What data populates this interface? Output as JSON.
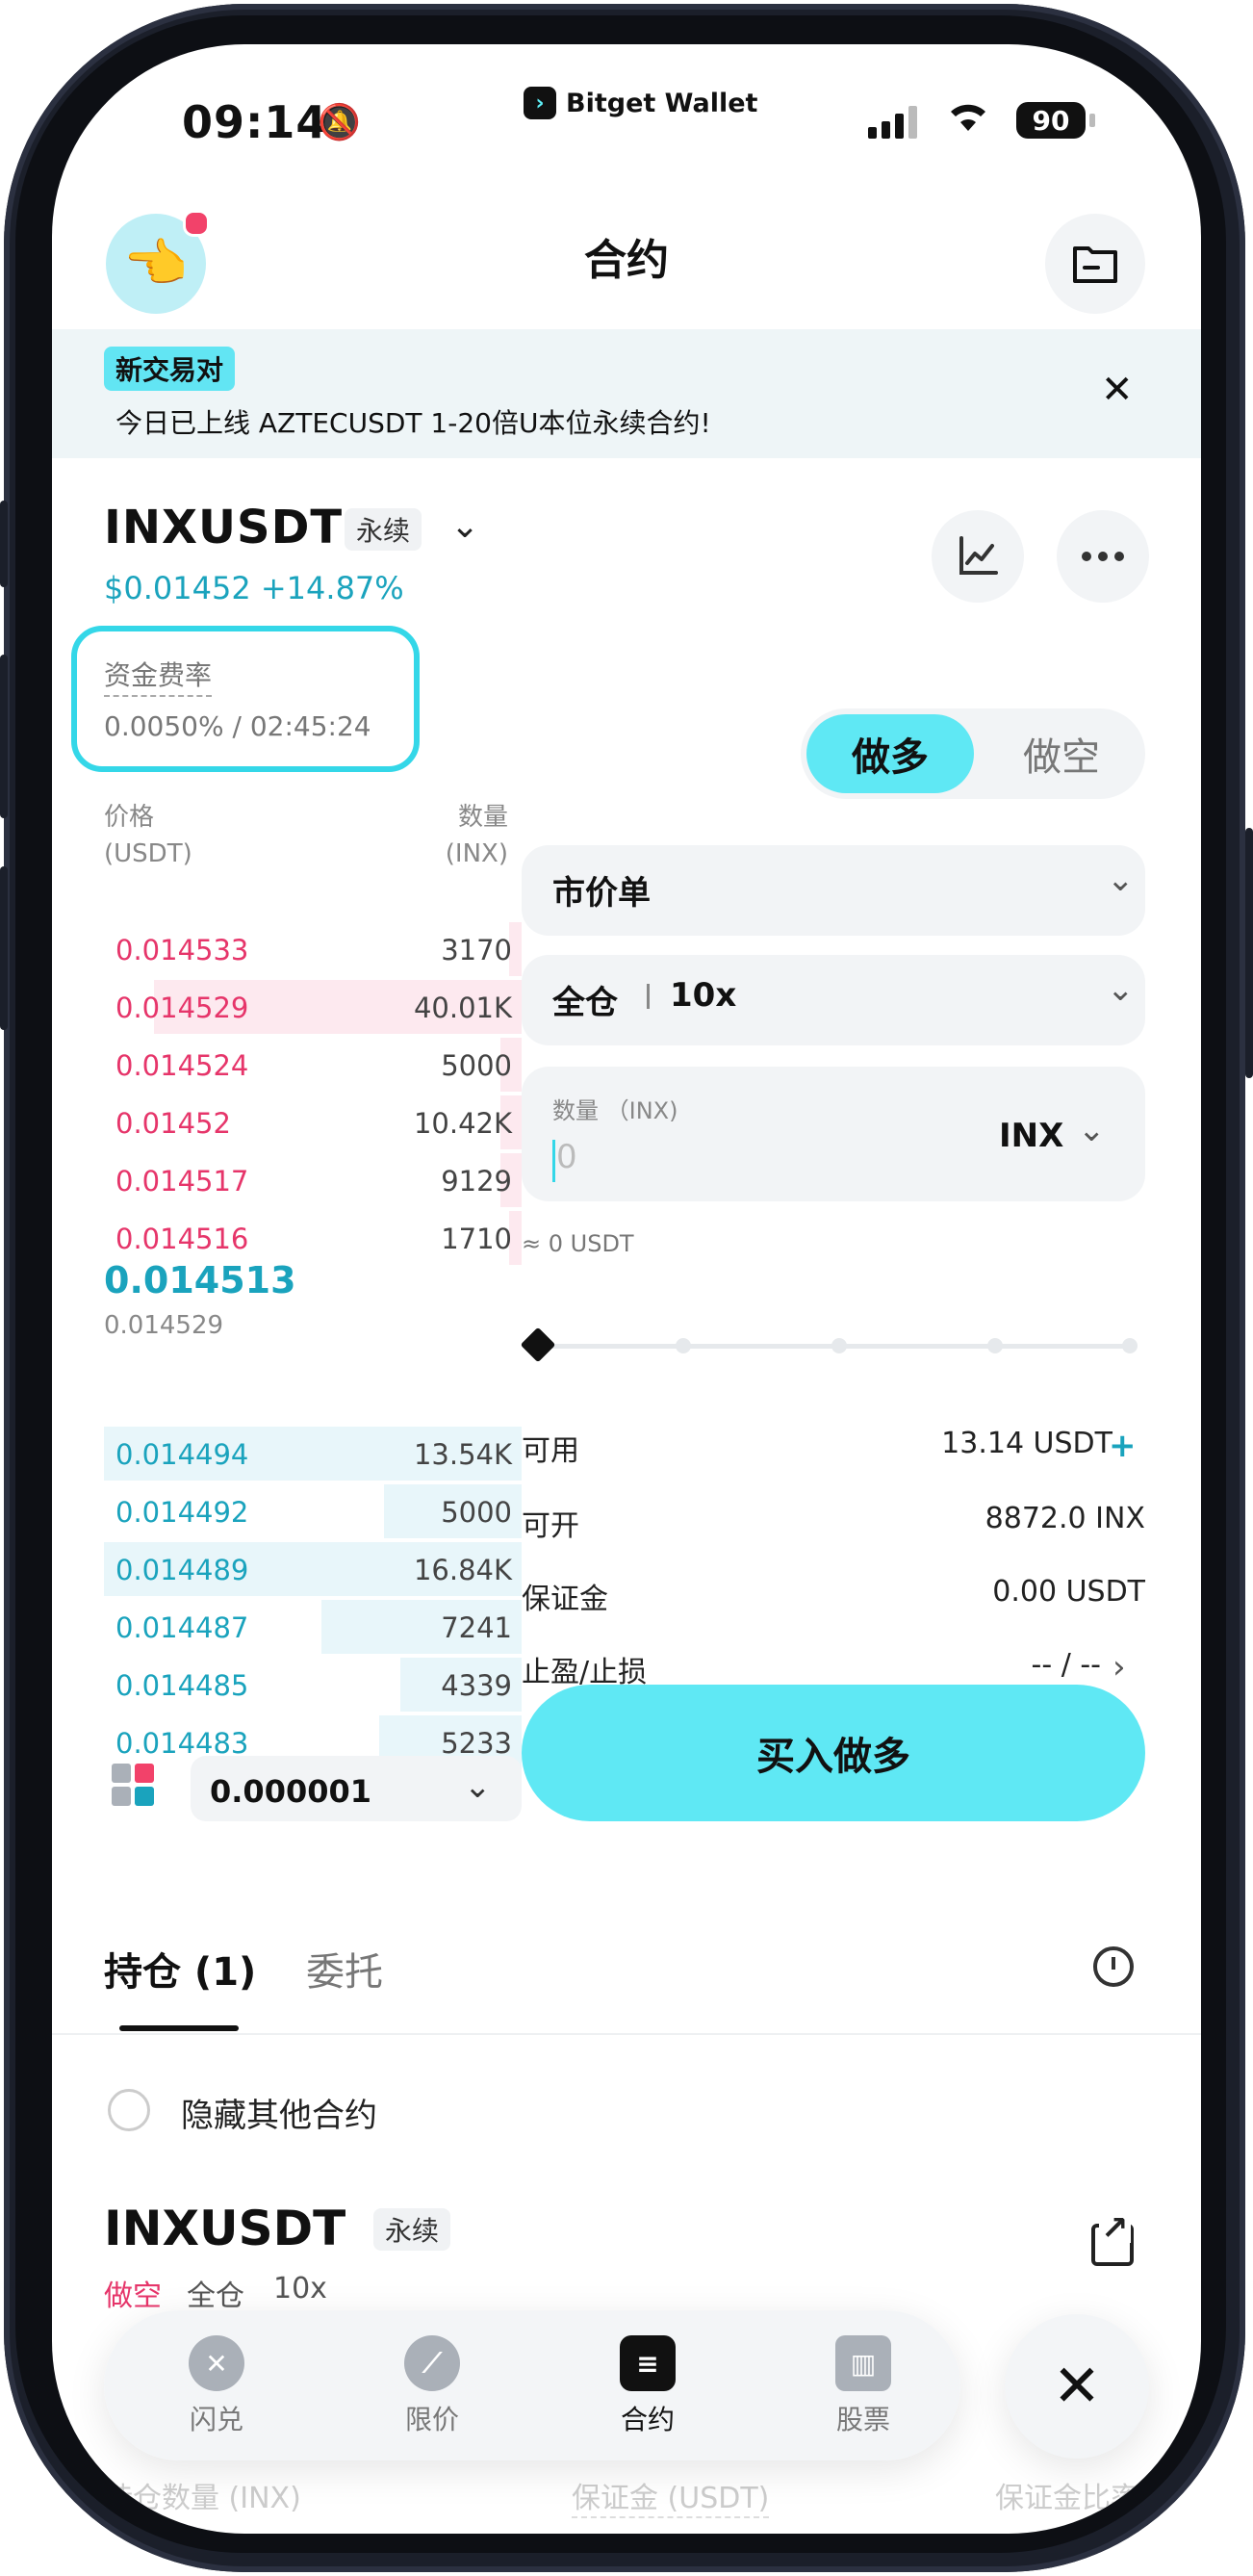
{
  "status": {
    "time": "09:14",
    "brand": "Bitget Wallet",
    "battery": "90"
  },
  "header": {
    "title": "合约"
  },
  "banner": {
    "tag": "新交易对",
    "text": "今日已上线 AZTECUSDT 1-20倍U本位永续合约!"
  },
  "pair": {
    "symbol": "INXUSDT",
    "type": "永续",
    "price_change": "$0.01452 +14.87%"
  },
  "funding": {
    "label": "资金费率",
    "value": "0.0050% / 02:45:24"
  },
  "orderbook": {
    "price_header": "价格",
    "price_unit": "(USDT)",
    "qty_header": "数量",
    "qty_unit": "(INX)",
    "asks": [
      {
        "price": "0.014533",
        "qty": "3170",
        "depth": 0.03
      },
      {
        "price": "0.014529",
        "qty": "40.01K",
        "depth": 0.88
      },
      {
        "price": "0.014524",
        "qty": "5000",
        "depth": 0.05
      },
      {
        "price": "0.01452",
        "qty": "10.42K",
        "depth": 0.05
      },
      {
        "price": "0.014517",
        "qty": "9129",
        "depth": 0.05
      },
      {
        "price": "0.014516",
        "qty": "1710",
        "depth": 0.03
      }
    ],
    "mid_price": "0.014513",
    "mark_price": "0.014529",
    "bids": [
      {
        "price": "0.014494",
        "qty": "13.54K",
        "depth": 1.0
      },
      {
        "price": "0.014492",
        "qty": "5000",
        "depth": 0.33
      },
      {
        "price": "0.014489",
        "qty": "16.84K",
        "depth": 1.0
      },
      {
        "price": "0.014487",
        "qty": "7241",
        "depth": 0.48
      },
      {
        "price": "0.014485",
        "qty": "4339",
        "depth": 0.29
      },
      {
        "price": "0.014483",
        "qty": "5233",
        "depth": 0.34
      }
    ],
    "precision": "0.000001"
  },
  "trade": {
    "long_label": "做多",
    "short_label": "做空",
    "order_type": "市价单",
    "margin_mode": "全仓",
    "leverage": "10x",
    "qty_label": "数量 （INX)",
    "qty_value": "0",
    "qty_unit": "INX",
    "approx": "≈ 0 USDT",
    "available_label": "可用",
    "available_value": "13.14 USDT",
    "openable_label": "可开",
    "openable_value": "8872.0 INX",
    "margin_label": "保证金",
    "margin_value": "0.00 USDT",
    "tpsl_label": "止盈/止损",
    "tpsl_value": "-- / --",
    "buy_button": "买入做多"
  },
  "positions": {
    "tab_positions": "持仓 (1)",
    "tab_orders": "委托",
    "hide_others": "隐藏其他合约",
    "item": {
      "symbol": "INXUSDT",
      "type": "永续",
      "side": "做空",
      "mode": "全仓",
      "leverage": "10x",
      "qty_label": "持仓数量 (INX)",
      "margin_label": "保证金 (USDT)",
      "margin_ratio_label": "保证金比率"
    }
  },
  "nav": {
    "items": [
      {
        "label": "闪兑",
        "icon": "swap-icon"
      },
      {
        "label": "限价",
        "icon": "limit-icon"
      },
      {
        "label": "合约",
        "icon": "futures-icon"
      },
      {
        "label": "股票",
        "icon": "stocks-icon"
      }
    ]
  },
  "colors": {
    "accent": "#5fe8f4",
    "up": "#1aa3bd",
    "down": "#e6356a",
    "highlight": "#34d7e8"
  }
}
